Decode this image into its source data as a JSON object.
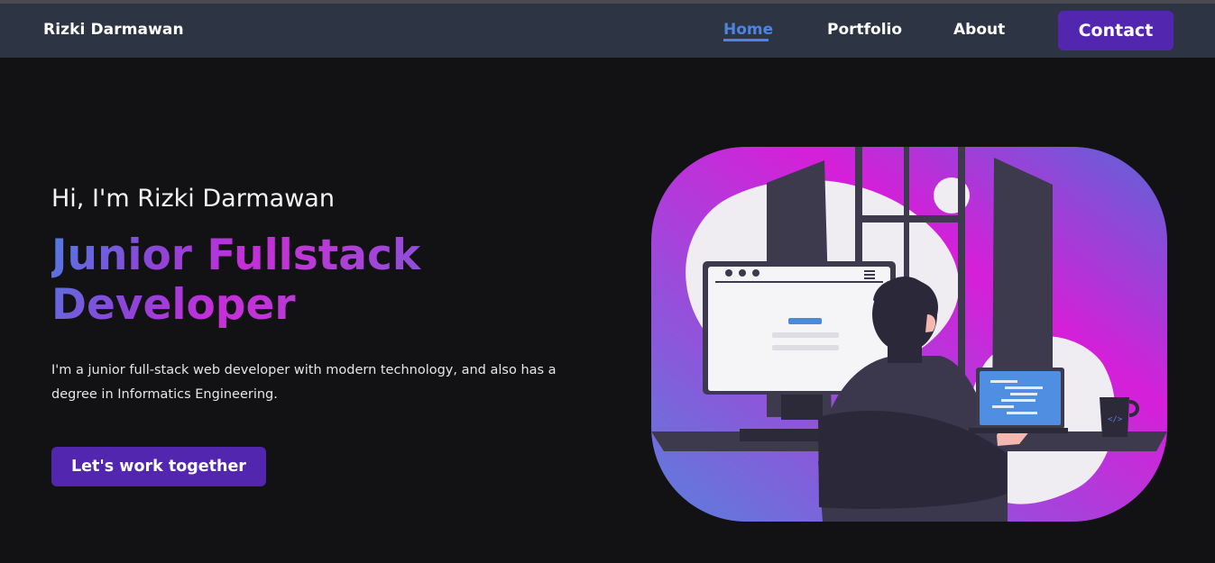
{
  "navbar": {
    "brand": "Rizki Darmawan",
    "links": [
      {
        "label": "Home",
        "active": true
      },
      {
        "label": "Portfolio",
        "active": false
      },
      {
        "label": "About",
        "active": false
      }
    ],
    "contact_label": "Contact"
  },
  "hero": {
    "greeting": "Hi, I'm Rizki Darmawan",
    "role": "Junior Fullstack Developer",
    "description": "I'm a junior full-stack web developer with modern technology, and also has a degree in Informatics Engineering.",
    "cta_label": "Let's work together"
  },
  "colors": {
    "background": "#121215",
    "navbar": "#2d3443",
    "accent": "#5326b0",
    "active_link": "#4f83e0",
    "gradient": [
      "#4f7de0",
      "#c62ed8"
    ]
  },
  "illustration": {
    "subject": "developer-at-desk",
    "icons": [
      "browser-window-icon",
      "laptop-code-icon",
      "coffee-mug-icon"
    ]
  }
}
